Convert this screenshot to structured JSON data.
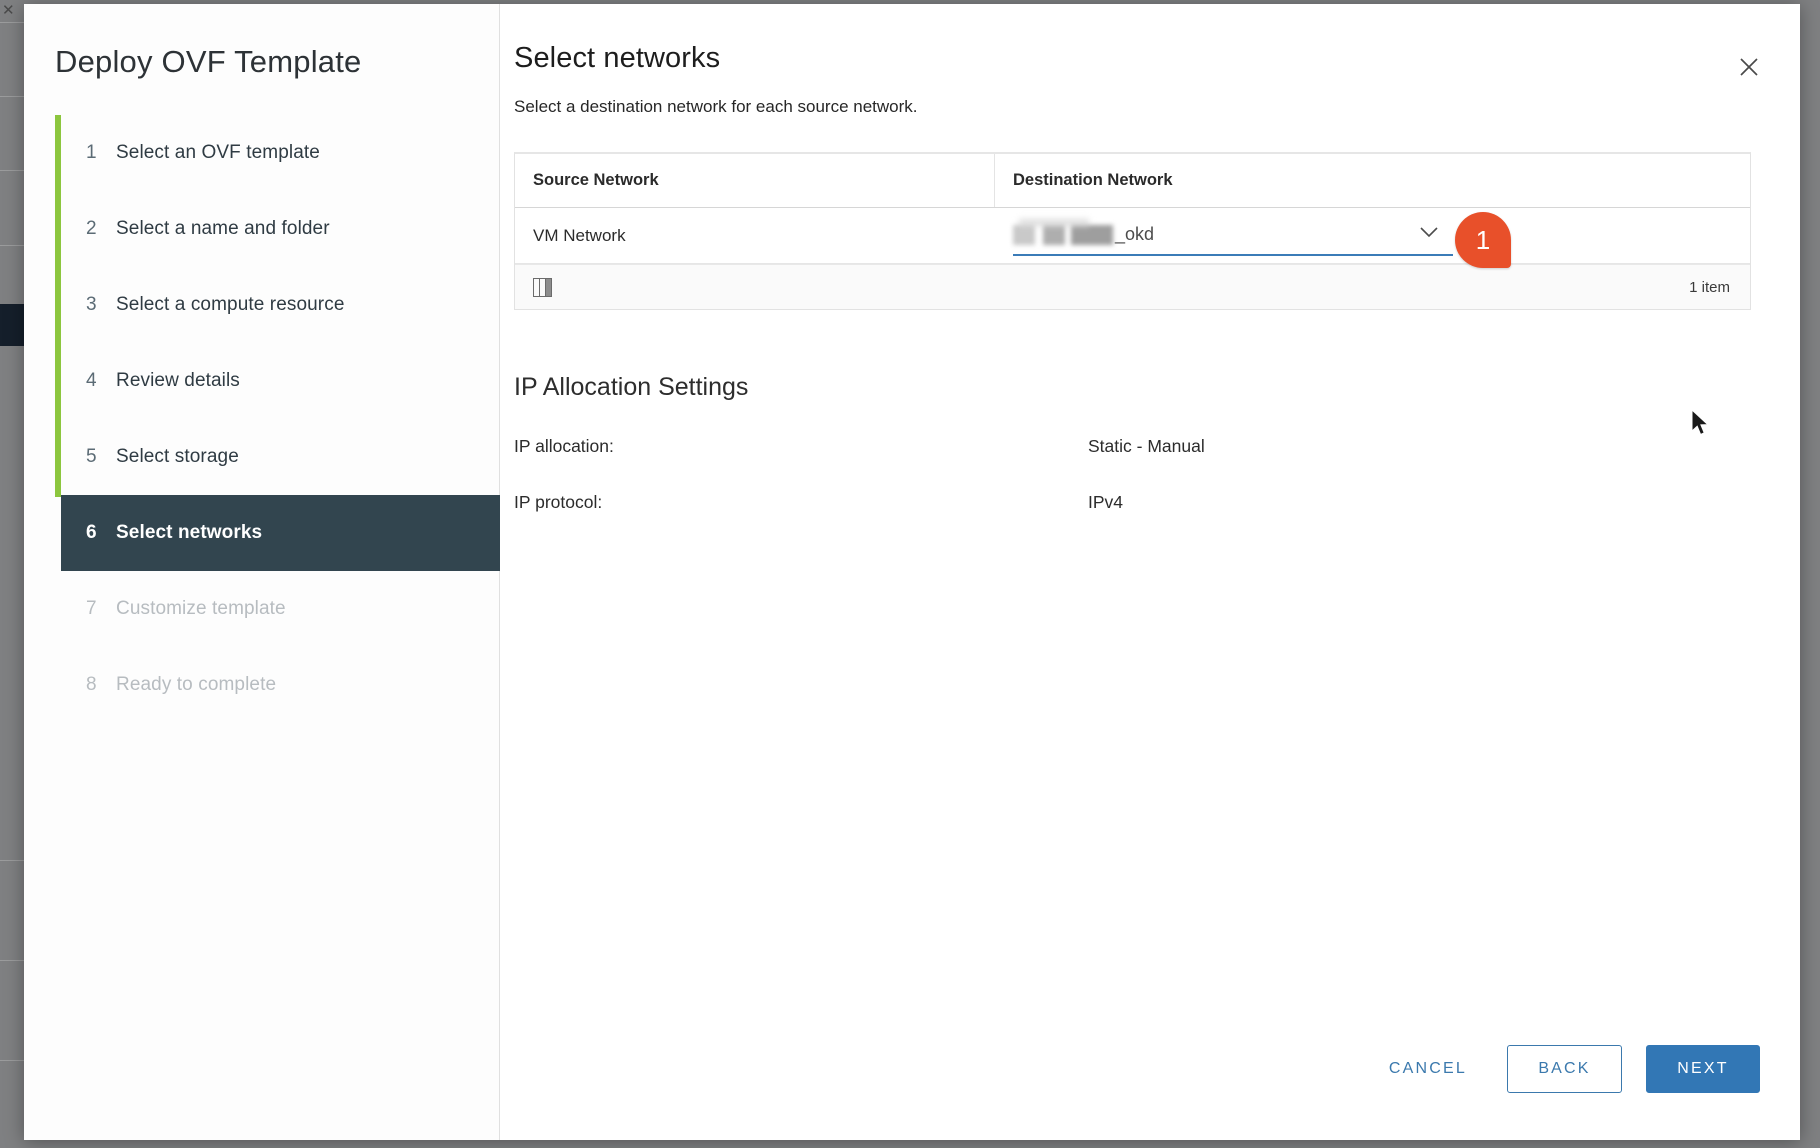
{
  "wizard": {
    "title": "Deploy OVF Template",
    "steps": [
      {
        "num": "1",
        "label": "Select an OVF template",
        "state": "done"
      },
      {
        "num": "2",
        "label": "Select a name and folder",
        "state": "done"
      },
      {
        "num": "3",
        "label": "Select a compute resource",
        "state": "done"
      },
      {
        "num": "4",
        "label": "Review details",
        "state": "done"
      },
      {
        "num": "5",
        "label": "Select storage",
        "state": "done"
      },
      {
        "num": "6",
        "label": "Select networks",
        "state": "active"
      },
      {
        "num": "7",
        "label": "Customize template",
        "state": "future"
      },
      {
        "num": "8",
        "label": "Ready to complete",
        "state": "future"
      }
    ]
  },
  "header": {
    "title": "Select networks",
    "subtitle": "Select a destination network for each source network.",
    "close_icon": "close-icon"
  },
  "table": {
    "columns": [
      "Source Network",
      "Destination Network"
    ],
    "rows": [
      {
        "source": "VM Network",
        "destination_suffix": "_okd"
      }
    ],
    "footer": {
      "columns_icon": "columns-icon",
      "item_count": "1 item"
    },
    "select": {
      "chevron_icon": "chevron-down-icon"
    }
  },
  "callouts": [
    {
      "id": "1",
      "label": "1"
    }
  ],
  "ip_allocation": {
    "heading": "IP Allocation Settings",
    "rows": [
      {
        "label": "IP allocation:",
        "value": "Static - Manual"
      },
      {
        "label": "IP protocol:",
        "value": "IPv4"
      }
    ]
  },
  "footer": {
    "cancel_label": "CANCEL",
    "back_label": "BACK",
    "next_label": "NEXT"
  },
  "colors": {
    "accent_green": "#8cc63e",
    "active_step_bg": "#32454f",
    "primary_button": "#3277b5",
    "link_blue": "#3b79ad",
    "callout_orange": "#e8502a",
    "select_underline": "#3b7cb8"
  }
}
